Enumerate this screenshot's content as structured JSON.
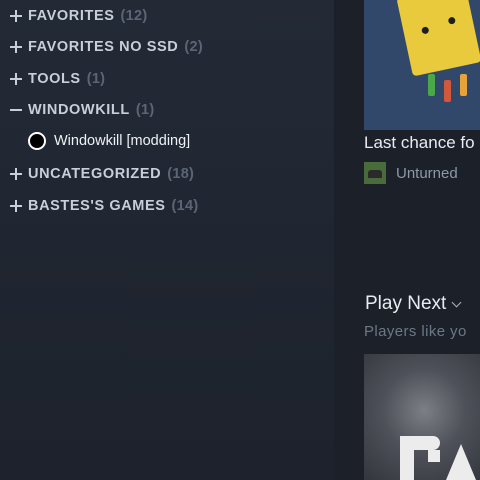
{
  "sidebar": {
    "categories": [
      {
        "name": "FAVORITES",
        "count": "(12)",
        "expanded": false
      },
      {
        "name": "FAVORITES NO SSD",
        "count": "(2)",
        "expanded": false
      },
      {
        "name": "TOOLS",
        "count": "(1)",
        "expanded": false
      },
      {
        "name": "WINDOWKILL",
        "count": "(1)",
        "expanded": true
      },
      {
        "name": "UNCATEGORIZED",
        "count": "(18)",
        "expanded": false
      },
      {
        "name": "BASTES'S GAMES",
        "count": "(14)",
        "expanded": false
      }
    ],
    "game": {
      "name": "Windowkill [modding]",
      "icon": "circle-icon"
    }
  },
  "main": {
    "recent": {
      "label": "Last chance fo",
      "game_name": "Unturned"
    },
    "play_next": {
      "title": "Play Next",
      "subtitle": "Players like yo"
    }
  },
  "colors": {
    "background": "#1e2431",
    "text": "#c7cfd9",
    "muted": "#5b6575"
  }
}
